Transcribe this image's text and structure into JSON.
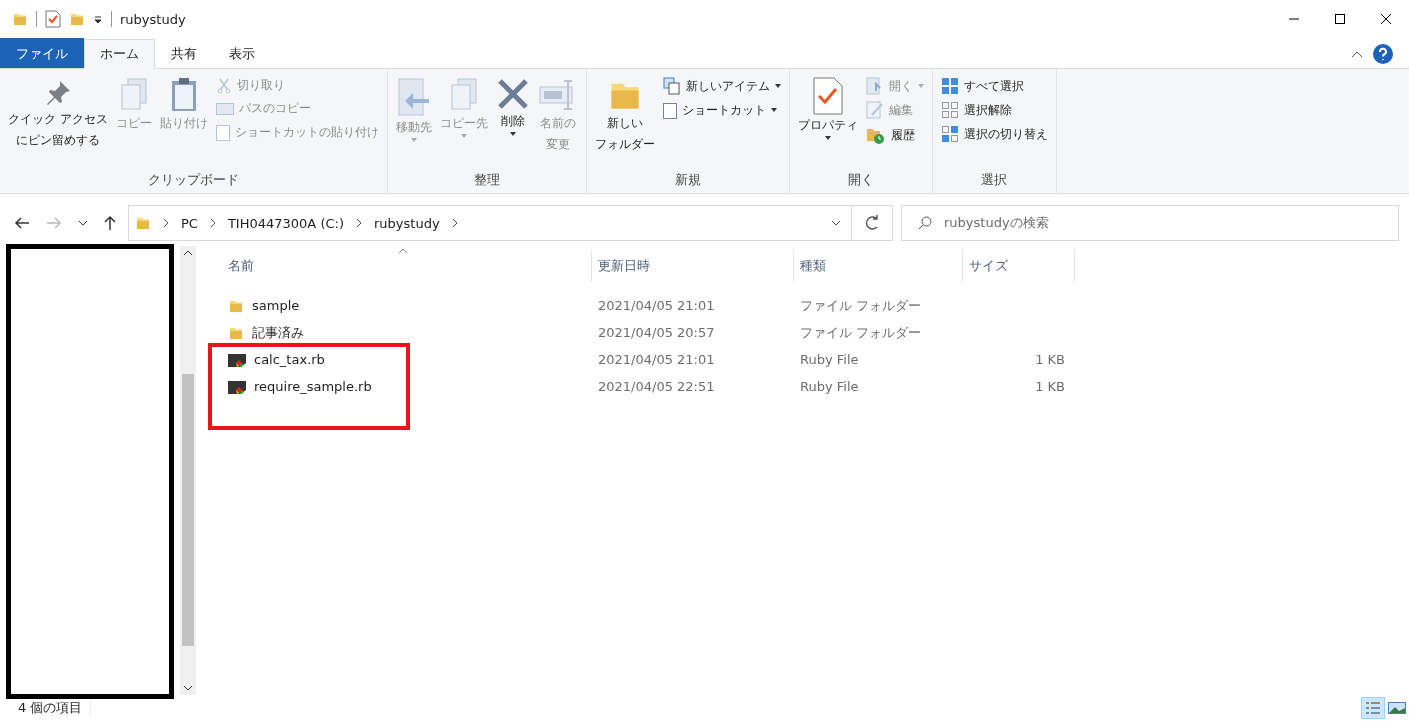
{
  "window": {
    "title": "rubystudy"
  },
  "quick_access": [
    {
      "kind": "folder"
    },
    {
      "kind": "properties"
    },
    {
      "kind": "folder"
    },
    {
      "kind": "caret"
    }
  ],
  "tabs": [
    {
      "label": "ファイル",
      "kind": "file",
      "selected": false
    },
    {
      "label": "ホーム",
      "kind": "tab",
      "selected": true
    },
    {
      "label": "共有",
      "kind": "tab",
      "selected": false
    },
    {
      "label": "表示",
      "kind": "tab",
      "selected": false
    }
  ],
  "ribbon": [
    {
      "label": "クリップボード",
      "items": [
        {
          "kind": "large",
          "lines": [
            "クイック アクセス",
            "にピン留めする"
          ],
          "disabled": false,
          "dropdown": false
        },
        {
          "kind": "large",
          "lines": [
            "コピー"
          ],
          "disabled": true,
          "dropdown": false
        },
        {
          "kind": "large",
          "lines": [
            "貼り付け"
          ],
          "disabled": true,
          "dropdown": false
        },
        {
          "kind": "stack",
          "items": [
            {
              "label": "切り取り",
              "disabled": true,
              "dropdown": false
            },
            {
              "label": "パスのコピー",
              "disabled": true,
              "dropdown": false
            },
            {
              "label": "ショートカットの貼り付け",
              "disabled": true,
              "dropdown": false
            }
          ]
        }
      ]
    },
    {
      "label": "整理",
      "items": [
        {
          "kind": "large",
          "lines": [
            "移動先"
          ],
          "disabled": true,
          "dropdown": true
        },
        {
          "kind": "large",
          "lines": [
            "コピー先"
          ],
          "disabled": true,
          "dropdown": true
        },
        {
          "kind": "large",
          "lines": [
            "削除"
          ],
          "disabled": false,
          "dropdown": true
        },
        {
          "kind": "large",
          "lines": [
            "名前の",
            "変更"
          ],
          "disabled": true,
          "dropdown": false
        }
      ]
    },
    {
      "label": "新規",
      "items": [
        {
          "kind": "large",
          "lines": [
            "新しい",
            "フォルダー"
          ],
          "disabled": false,
          "dropdown": false
        },
        {
          "kind": "stack",
          "items": [
            {
              "label": "新しいアイテム",
              "disabled": false,
              "dropdown": true
            },
            {
              "label": "ショートカット",
              "disabled": false,
              "dropdown": true
            }
          ]
        }
      ]
    },
    {
      "label": "開く",
      "items": [
        {
          "kind": "large",
          "lines": [
            "プロパティ"
          ],
          "disabled": false,
          "dropdown": true
        },
        {
          "kind": "stack",
          "items": [
            {
              "label": "開く",
              "disabled": true,
              "dropdown": true
            },
            {
              "label": "編集",
              "disabled": true,
              "dropdown": false
            },
            {
              "label": "履歴",
              "disabled": false,
              "dropdown": false
            }
          ]
        }
      ]
    },
    {
      "label": "選択",
      "items": [
        {
          "kind": "stack",
          "items": [
            {
              "label": "すべて選択",
              "disabled": false,
              "dropdown": false
            },
            {
              "label": "選択解除",
              "disabled": false,
              "dropdown": false
            },
            {
              "label": "選択の切り替え",
              "disabled": false,
              "dropdown": false
            }
          ]
        }
      ]
    }
  ],
  "address": {
    "crumbs": [
      "PC",
      "TIH0447300A (C:)",
      "rubystudy"
    ],
    "search_placeholder": "rubystudyの検索"
  },
  "columns": [
    "名前",
    "更新日時",
    "種類",
    "サイズ"
  ],
  "file_groups": [
    {
      "framed": false,
      "files": [
        {
          "name": "sample",
          "modified": "2021/04/05 21:01",
          "type": "ファイル フォルダー",
          "kind": "folder"
        },
        {
          "name": "記事済み",
          "modified": "2021/04/05 20:57",
          "type": "ファイル フォルダー",
          "kind": "folder"
        }
      ]
    },
    {
      "framed": true,
      "files": [
        {
          "name": "calc_tax.rb",
          "modified": "2021/04/05 21:01",
          "type": "Ruby File",
          "size": "1 KB",
          "kind": "ruby"
        },
        {
          "name": "require_sample.rb",
          "modified": "2021/04/05 22:51",
          "type": "Ruby File",
          "size": "1 KB",
          "kind": "ruby"
        }
      ]
    }
  ],
  "status_bar": {
    "count": "4 個の項目",
    "views": [
      {
        "kind": "details",
        "selected": true
      },
      {
        "kind": "thumbnails",
        "selected": false
      }
    ]
  }
}
